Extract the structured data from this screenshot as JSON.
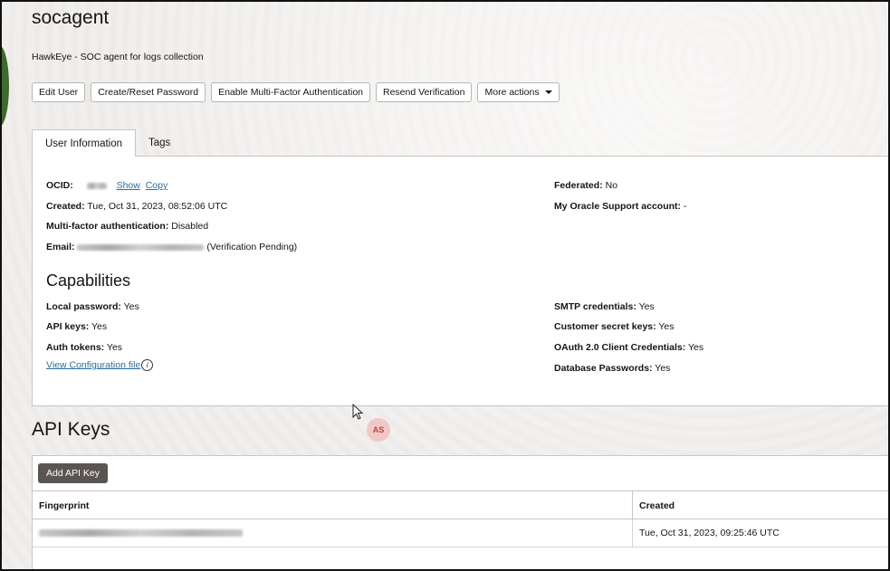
{
  "user": {
    "name": "socagent",
    "description": "HawkEye - SOC agent for logs collection"
  },
  "actions": {
    "edit_user": "Edit User",
    "create_reset_password": "Create/Reset Password",
    "enable_mfa": "Enable Multi-Factor Authentication",
    "resend_verification": "Resend Verification",
    "more_actions": "More actions"
  },
  "tabs": [
    {
      "label": "User Information",
      "active": true
    },
    {
      "label": "Tags",
      "active": false
    }
  ],
  "info": {
    "ocid_label": "OCID:",
    "show": "Show",
    "copy": "Copy",
    "created_label": "Created:",
    "created_value": "Tue, Oct 31, 2023, 08:52:06 UTC",
    "mfa_label": "Multi-factor authentication:",
    "mfa_value": "Disabled",
    "email_label": "Email:",
    "email_suffix": "(Verification Pending)",
    "federated_label": "Federated:",
    "federated_value": "No",
    "support_label": "My Oracle Support account:",
    "support_value": "-"
  },
  "capabilities": {
    "heading": "Capabilities",
    "local_password_label": "Local password:",
    "local_password_value": "Yes",
    "api_keys_label": "API keys:",
    "api_keys_value": "Yes",
    "auth_tokens_label": "Auth tokens:",
    "auth_tokens_value": "Yes",
    "view_config": "View Configuration file",
    "smtp_label": "SMTP credentials:",
    "smtp_value": "Yes",
    "customer_secret_label": "Customer secret keys:",
    "customer_secret_value": "Yes",
    "oauth_label": "OAuth 2.0 Client Credentials:",
    "oauth_value": "Yes",
    "db_passwords_label": "Database Passwords:",
    "db_passwords_value": "Yes"
  },
  "overlay": {
    "avatar_initials": "AS"
  },
  "api_keys": {
    "heading": "API Keys",
    "add_button": "Add API Key",
    "columns": [
      "Fingerprint",
      "Created"
    ],
    "rows": [
      {
        "created": "Tue, Oct 31, 2023, 09:25:46 UTC"
      }
    ]
  },
  "icons": {
    "dropdown": "chevron-down-icon",
    "info": "info-icon",
    "cursor": "mouse-pointer-icon"
  }
}
